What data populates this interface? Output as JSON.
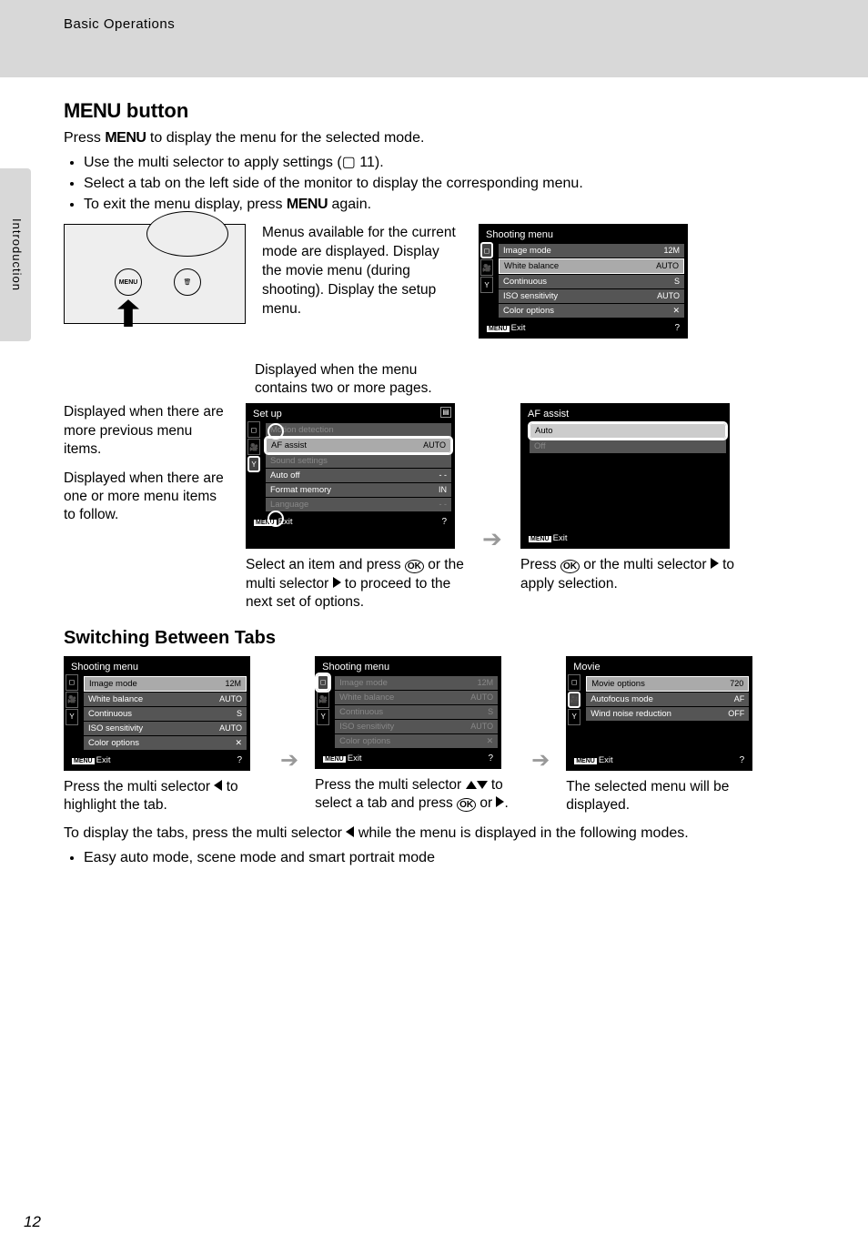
{
  "header": {
    "breadcrumb": "Basic Operations",
    "side_tab": "Introduction",
    "page_num": "12"
  },
  "section1": {
    "title_prefix": "MENU",
    "title_suffix": " button",
    "intro": "Press MENU to display the menu for the selected mode.",
    "bullets": [
      "Use the multi selector to apply settings (📖 11).",
      "Select a tab on the left side of the monitor to display the corresponding menu.",
      "To exit the menu display, press MENU again."
    ],
    "desc_lines": "Menus available for the current mode are displayed. Display the movie menu (during shooting). Display the setup menu.",
    "shooting_menu": {
      "title": "Shooting menu",
      "items": [
        {
          "label": "Image mode",
          "value": "12M"
        },
        {
          "label": "White balance",
          "value": "AUTO"
        },
        {
          "label": "Continuous",
          "value": "S"
        },
        {
          "label": "ISO sensitivity",
          "value": "AUTO"
        },
        {
          "label": "Color options",
          "value": "✕"
        }
      ],
      "exit": "Exit",
      "help": "?"
    }
  },
  "section2": {
    "above_caption": "Displayed when the menu contains two or more pages.",
    "left_p1": "Displayed when there are more previous menu items.",
    "left_p2": "Displayed when there are one or more menu items to follow.",
    "setup_menu": {
      "title": "Set up",
      "items": [
        {
          "label": "Motion detection",
          "value": "",
          "dim": true
        },
        {
          "label": "AF assist",
          "value": "AUTO",
          "selected": true
        },
        {
          "label": "Sound settings",
          "value": "",
          "dim": true
        },
        {
          "label": "Auto off",
          "value": "- -"
        },
        {
          "label": "Format memory",
          "value": "IN"
        },
        {
          "label": "Language",
          "value": "- -",
          "dim": true
        }
      ],
      "exit": "Exit",
      "help": "?"
    },
    "mid_caption": "Select an item and press 🄋 or the multi selector ▶ to proceed to the next set of options.",
    "af_menu": {
      "title": "AF assist",
      "items": [
        {
          "label": "Auto",
          "value": "",
          "selected": true
        },
        {
          "label": "Off",
          "value": "",
          "dim": true
        }
      ],
      "exit": "Exit"
    },
    "right_caption": "Press 🄋 or the multi selector ▶ to apply selection."
  },
  "section3": {
    "title": "Switching Between Tabs",
    "menu_a": {
      "title": "Shooting menu",
      "items": [
        {
          "label": "Image mode",
          "value": "12M"
        },
        {
          "label": "White balance",
          "value": "AUTO"
        },
        {
          "label": "Continuous",
          "value": "S"
        },
        {
          "label": "ISO sensitivity",
          "value": "AUTO"
        },
        {
          "label": "Color options",
          "value": "✕"
        }
      ],
      "exit": "Exit",
      "help": "?"
    },
    "cap_a": "Press the multi selector ◀ to highlight the tab.",
    "menu_b": {
      "title": "Shooting menu",
      "items": [
        {
          "label": "Image mode",
          "value": "12M",
          "dim": true
        },
        {
          "label": "White balance",
          "value": "AUTO",
          "dim": true
        },
        {
          "label": "Continuous",
          "value": "S",
          "dim": true
        },
        {
          "label": "ISO sensitivity",
          "value": "AUTO",
          "dim": true
        },
        {
          "label": "Color options",
          "value": "✕",
          "dim": true
        }
      ],
      "exit": "Exit",
      "help": "?"
    },
    "cap_b": "Press the multi selector ▲▼ to select a tab and press 🄋 or ▶.",
    "menu_c": {
      "title": "Movie",
      "items": [
        {
          "label": "Movie options",
          "value": "720"
        },
        {
          "label": "Autofocus mode",
          "value": "AF"
        },
        {
          "label": "Wind noise reduction",
          "value": "OFF"
        }
      ],
      "exit": "Exit",
      "help": "?"
    },
    "cap_c": "The selected menu will be displayed.",
    "footer_para": "To display the tabs, press the multi selector ◀ while the menu is displayed in the following modes.",
    "footer_bullet": "Easy auto mode, scene mode and smart portrait mode"
  }
}
